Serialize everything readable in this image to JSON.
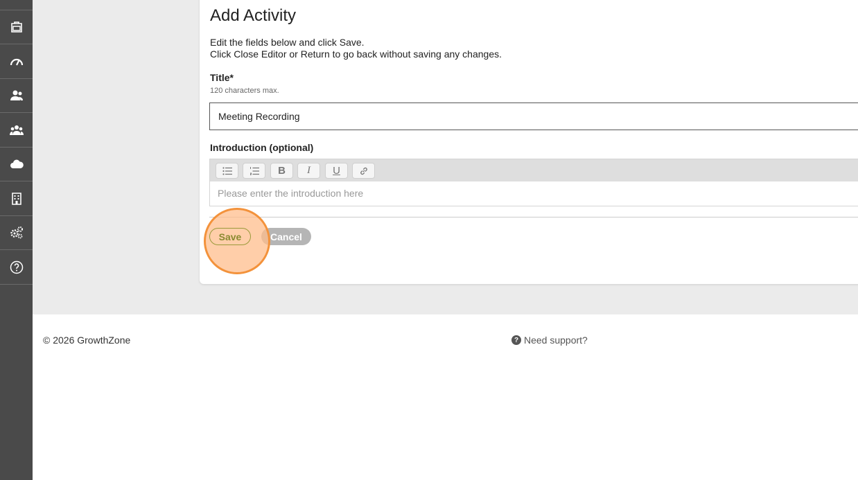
{
  "form": {
    "heading": "Add Activity",
    "instruction_line1": "Edit the fields below and click Save.",
    "instruction_line2": "Click Close Editor or Return to go back without saving any changes.",
    "title_label": "Title",
    "title_required_mark": "*",
    "title_hint": "120 characters max.",
    "title_value": "Meeting Recording",
    "intro_label": "Introduction (optional)",
    "intro_placeholder": "Please enter the introduction here",
    "save_label": "Save",
    "cancel_label": "Cancel"
  },
  "toolbar": {
    "bold_glyph": "B",
    "italic_glyph": "I",
    "underline_glyph": "U"
  },
  "sidebar": {
    "icons": [
      "briefcase-icon",
      "dashboard-gauge-icon",
      "contacts-icon",
      "groups-icon",
      "cloud-icon",
      "building-icon",
      "settings-gears-icon",
      "help-icon"
    ]
  },
  "footer": {
    "copyright": "© 2026 GrowthZone",
    "support_label": "Need support?",
    "support_glyph": "?"
  },
  "colors": {
    "sidebar_bg": "#4a4a4a",
    "save_text": "#8a8a30",
    "cancel_bg": "#b5b5b5",
    "click_highlight": "#f3923b"
  }
}
